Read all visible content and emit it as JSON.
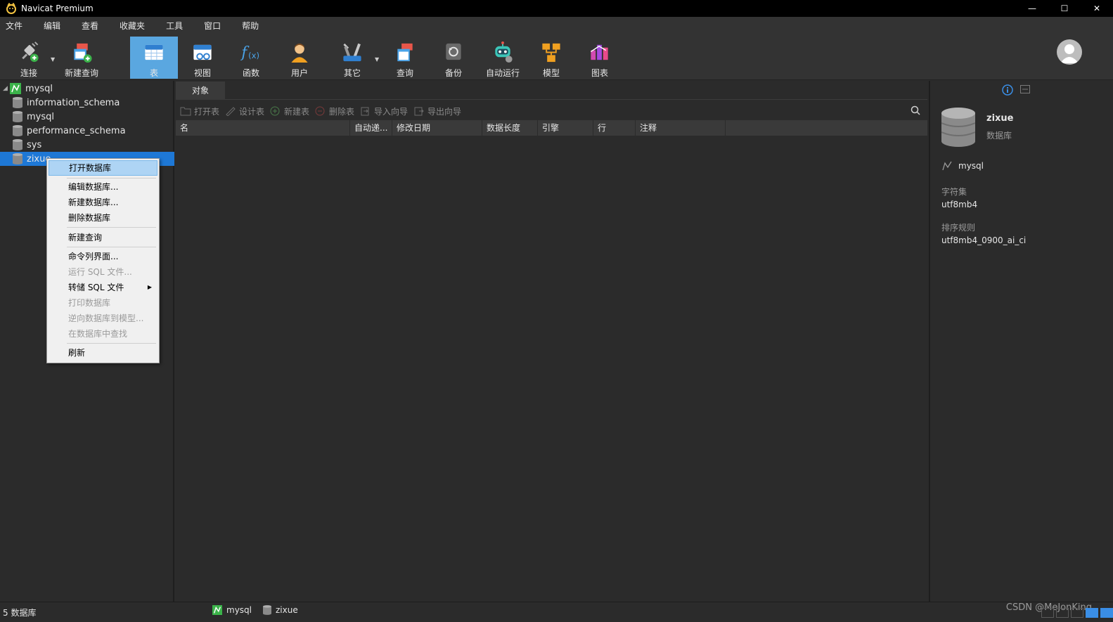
{
  "window": {
    "title": "Navicat Premium",
    "minimize": "—",
    "maximize": "☐",
    "close": "✕"
  },
  "menubar": {
    "items": [
      "文件",
      "编辑",
      "查看",
      "收藏夹",
      "工具",
      "窗口",
      "帮助"
    ]
  },
  "toolbar": {
    "connect": "连接",
    "new_query": "新建查询",
    "table": "表",
    "view": "视图",
    "function": "函数",
    "user": "用户",
    "other": "其它",
    "query": "查询",
    "backup": "备份",
    "automation": "自动运行",
    "model": "模型",
    "chart": "图表",
    "active_tool": "表"
  },
  "nav": {
    "connection": "mysql",
    "databases": [
      "information_schema",
      "mysql",
      "performance_schema",
      "sys",
      "zixue"
    ],
    "selected": "zixue"
  },
  "context_menu": {
    "open_database": "打开数据库",
    "edit_database": "编辑数据库...",
    "new_database": "新建数据库...",
    "delete_database": "删除数据库",
    "new_query": "新建查询",
    "console": "命令列界面...",
    "run_sql_file": "运行 SQL 文件...",
    "dump_sql_file": "转储 SQL 文件",
    "print_database": "打印数据库",
    "reverse_to_model": "逆向数据库到模型...",
    "find_in_database": "在数据库中查找",
    "refresh": "刷新"
  },
  "main": {
    "tab": "对象",
    "toolbar": {
      "open_table": "打开表",
      "design_table": "设计表",
      "new_table": "新建表",
      "delete_table": "删除表",
      "import_wizard": "导入向导",
      "export_wizard": "导出向导"
    },
    "columns": [
      "名",
      "自动递...",
      "修改日期",
      "数据长度",
      "引擎",
      "行",
      "注释"
    ]
  },
  "info_panel": {
    "name": "zixue",
    "type": "数据库",
    "connection": "mysql",
    "charset_label": "字符集",
    "charset_value": "utf8mb4",
    "collation_label": "排序规则",
    "collation_value": "utf8mb4_0900_ai_ci"
  },
  "statusbar": {
    "count": "5 数据库",
    "connection": "mysql",
    "database": "zixue",
    "watermark": "CSDN @MeJonKing"
  },
  "colors": {
    "selection": "#1e78d6",
    "toolbar_active": "#5aa7e0",
    "menu_highlight": "#aed4f4"
  }
}
